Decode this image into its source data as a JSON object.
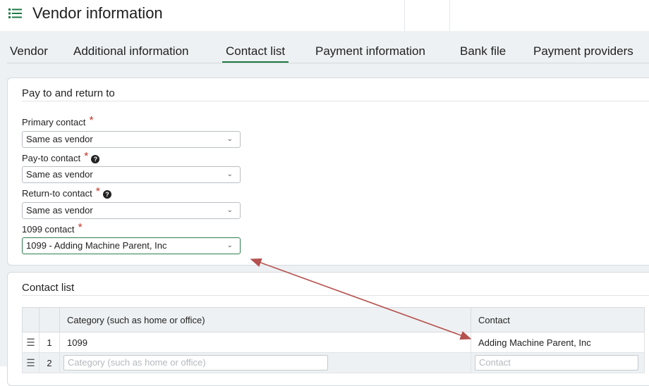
{
  "header": {
    "title": "Vendor information"
  },
  "tabs": [
    {
      "label": "Vendor"
    },
    {
      "label": "Additional information"
    },
    {
      "label": "Contact list"
    },
    {
      "label": "Payment information"
    },
    {
      "label": "Bank file"
    },
    {
      "label": "Payment providers"
    }
  ],
  "active_tab": "Contact list",
  "pay_section": {
    "title": "Pay to and return to",
    "fields": [
      {
        "label": "Primary contact",
        "value": "Same as vendor"
      },
      {
        "label": "Pay-to contact",
        "value": "Same as vendor"
      },
      {
        "label": "Return-to contact",
        "value": "Same as vendor"
      },
      {
        "label": "1099 contact",
        "value": "1099 - Adding Machine Parent, Inc"
      }
    ]
  },
  "contact_section": {
    "title": "Contact list",
    "columns": [
      "Category (such as home or office)",
      "Contact"
    ],
    "rows": [
      {
        "num": "1",
        "category": "1099",
        "contact": "Adding Machine Parent, Inc"
      },
      {
        "num": "2",
        "category_placeholder": "Category (such as home or office)",
        "contact_placeholder": "Contact"
      }
    ]
  },
  "colors": {
    "accent": "#1f7a45",
    "required": "#c0392b",
    "annotation_arrow": "#b5524f"
  }
}
